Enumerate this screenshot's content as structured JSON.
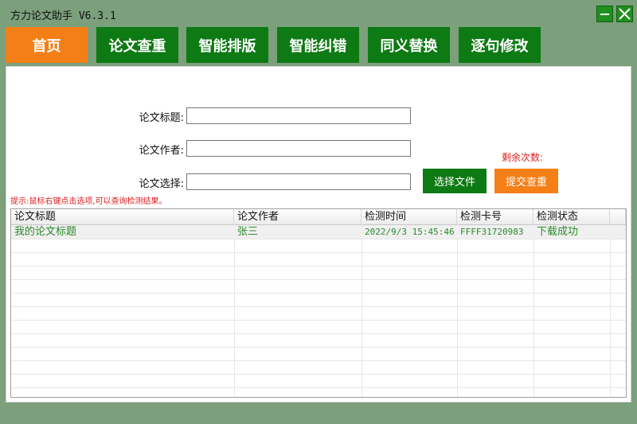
{
  "app": {
    "title": "方力论文助手 V6.3.1"
  },
  "window_controls": {
    "minimize_icon": "minimize-icon",
    "close_icon": "close-icon"
  },
  "tabs": [
    {
      "label": "首页",
      "active": true
    },
    {
      "label": "论文查重",
      "active": false
    },
    {
      "label": "智能排版",
      "active": false
    },
    {
      "label": "智能纠错",
      "active": false
    },
    {
      "label": "同义替换",
      "active": false
    },
    {
      "label": "逐句修改",
      "active": false
    }
  ],
  "form": {
    "title_label": "论文标题:",
    "title_value": "",
    "author_label": "论文作者:",
    "author_value": "",
    "file_label": "论文选择:",
    "file_value": "",
    "remaining_label": "剩余次数:",
    "select_file_button": "选择文件",
    "submit_button": "提交查重",
    "hint": "提示:鼠标右键点击选项,可以查询检测结果。"
  },
  "table": {
    "columns": [
      "论文标题",
      "论文作者",
      "检测时间",
      "检测卡号",
      "检测状态"
    ],
    "rows": [
      [
        "我的论文标题",
        "张三",
        "2022/9/3 15:45:46",
        "FFFF31720983",
        "下载成功"
      ]
    ]
  },
  "colors": {
    "background": "#7c9f7c",
    "tab_green": "#0d7a13",
    "tab_active_orange": "#f57f17",
    "hint_red": "#e02020",
    "row_text_green": "#2a8a2a"
  }
}
